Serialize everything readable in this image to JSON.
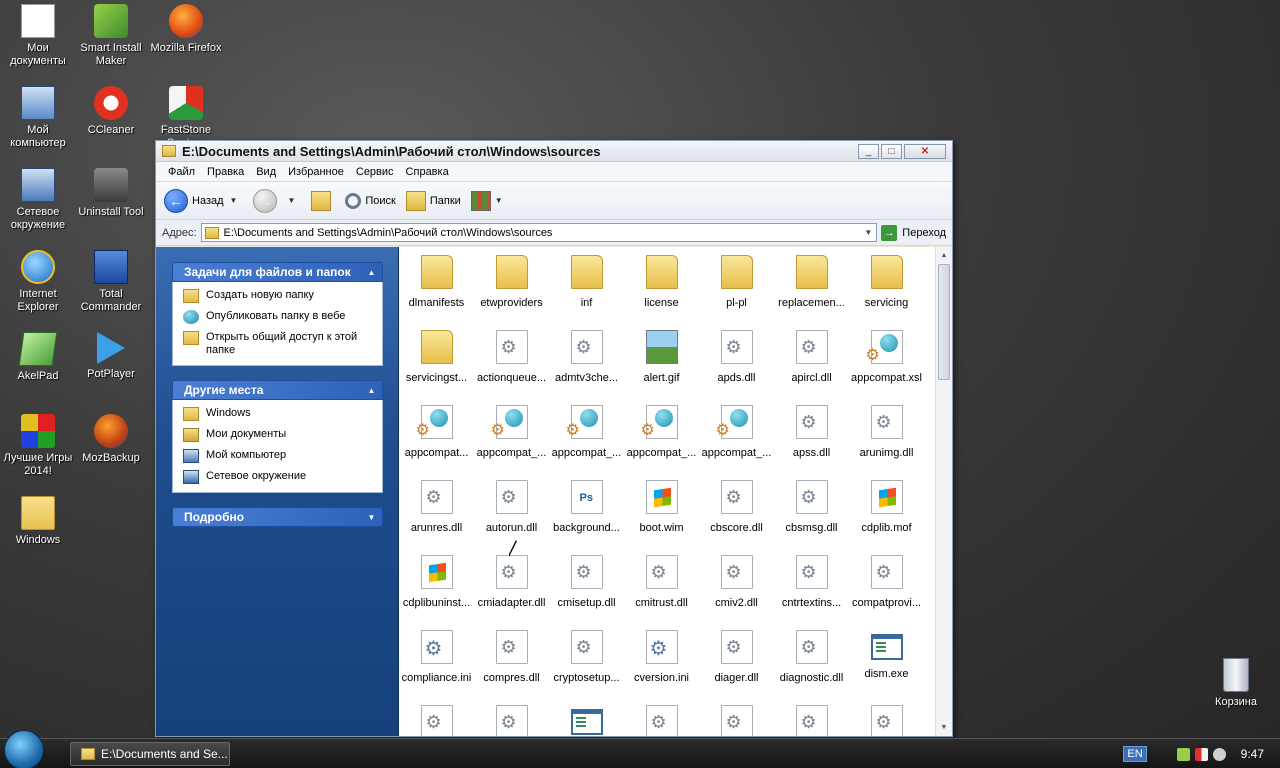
{
  "desktop": {
    "icons": [
      {
        "label": "Мои документы"
      },
      {
        "label": "Smart Install Maker"
      },
      {
        "label": "Mozilla Firefox"
      },
      {
        "label": "Мой компьютер"
      },
      {
        "label": "CCleaner"
      },
      {
        "label": "FastStone Capture"
      },
      {
        "label": "Сетевое окружение"
      },
      {
        "label": "Uninstall Tool"
      },
      {
        "label": "Internet Explorer"
      },
      {
        "label": "Total Commander"
      },
      {
        "label": "AkelPad"
      },
      {
        "label": "PotPlayer"
      },
      {
        "label": "Лучшие Игры 2014!"
      },
      {
        "label": "MozBackup"
      },
      {
        "label": "Windows"
      },
      {
        "label": "Корзина"
      }
    ]
  },
  "window": {
    "title": "E:\\Documents and Settings\\Admin\\Рабочий стол\\Windows\\sources",
    "minimize": "_",
    "maximize": "□",
    "close": "✕"
  },
  "menu": [
    "Файл",
    "Правка",
    "Вид",
    "Избранное",
    "Сервис",
    "Справка"
  ],
  "toolbar": {
    "back_label": "Назад",
    "search_label": "Поиск",
    "folders_label": "Папки"
  },
  "address": {
    "label": "Адрес:",
    "value": "E:\\Documents and Settings\\Admin\\Рабочий стол\\Windows\\sources",
    "go_label": "Переход"
  },
  "tasks": {
    "file_tasks": {
      "title": "Задачи для файлов и папок",
      "items": [
        "Создать новую папку",
        "Опубликовать папку в вебе",
        "Открыть общий доступ к этой папке"
      ]
    },
    "other_places": {
      "title": "Другие места",
      "items": [
        "Windows",
        "Мои документы",
        "Мой компьютер",
        "Сетевое окружение"
      ]
    },
    "details": {
      "title": "Подробно"
    }
  },
  "files": [
    {
      "name": "dlmanifests",
      "icon": "folder"
    },
    {
      "name": "etwproviders",
      "icon": "folder"
    },
    {
      "name": "inf",
      "icon": "folder"
    },
    {
      "name": "license",
      "icon": "folder"
    },
    {
      "name": "pl-pl",
      "icon": "folder"
    },
    {
      "name": "replacemen...",
      "icon": "folder"
    },
    {
      "name": "servicing",
      "icon": "folder"
    },
    {
      "name": "servicingst...",
      "icon": "folder"
    },
    {
      "name": "actionqueue...",
      "icon": "dll"
    },
    {
      "name": "admtv3che...",
      "icon": "dll"
    },
    {
      "name": "alert.gif",
      "icon": "image"
    },
    {
      "name": "apds.dll",
      "icon": "dll"
    },
    {
      "name": "apircl.dll",
      "icon": "dll"
    },
    {
      "name": "appcompat.xsl",
      "icon": "globe"
    },
    {
      "name": "appcompat...",
      "icon": "globe"
    },
    {
      "name": "appcompat_...",
      "icon": "globe"
    },
    {
      "name": "appcompat_...",
      "icon": "globe"
    },
    {
      "name": "appcompat_...",
      "icon": "globe"
    },
    {
      "name": "appcompat_...",
      "icon": "globe"
    },
    {
      "name": "apss.dll",
      "icon": "dll"
    },
    {
      "name": "arunimg.dll",
      "icon": "dll"
    },
    {
      "name": "arunres.dll",
      "icon": "dll"
    },
    {
      "name": "autorun.dll",
      "icon": "dll"
    },
    {
      "name": "background...",
      "icon": "ps"
    },
    {
      "name": "boot.wim",
      "icon": "win"
    },
    {
      "name": "cbscore.dll",
      "icon": "dll"
    },
    {
      "name": "cbsmsg.dll",
      "icon": "dll"
    },
    {
      "name": "cdplib.mof",
      "icon": "win"
    },
    {
      "name": "cdplibuninst...",
      "icon": "win"
    },
    {
      "name": "cmiadapter.dll",
      "icon": "dll"
    },
    {
      "name": "cmisetup.dll",
      "icon": "dll"
    },
    {
      "name": "cmitrust.dll",
      "icon": "dll"
    },
    {
      "name": "cmiv2.dll",
      "icon": "dll"
    },
    {
      "name": "cntrtextins...",
      "icon": "dll"
    },
    {
      "name": "compatprovi...",
      "icon": "dll"
    },
    {
      "name": "compliance.ini",
      "icon": "ini"
    },
    {
      "name": "compres.dll",
      "icon": "dll"
    },
    {
      "name": "cryptosetup...",
      "icon": "dll"
    },
    {
      "name": "cversion.ini",
      "icon": "ini"
    },
    {
      "name": "diager.dll",
      "icon": "dll"
    },
    {
      "name": "diagnostic.dll",
      "icon": "dll"
    },
    {
      "name": "dism.exe",
      "icon": "exe"
    },
    {
      "name": "",
      "icon": "dll"
    },
    {
      "name": "",
      "icon": "dll"
    },
    {
      "name": "",
      "icon": "exe"
    },
    {
      "name": "",
      "icon": "dll"
    },
    {
      "name": "",
      "icon": "dll"
    },
    {
      "name": "",
      "icon": "dll"
    },
    {
      "name": "",
      "icon": "dll"
    }
  ],
  "taskbar": {
    "task_label": "E:\\Documents and Se...",
    "lang": "EN",
    "clock": "9:47"
  }
}
